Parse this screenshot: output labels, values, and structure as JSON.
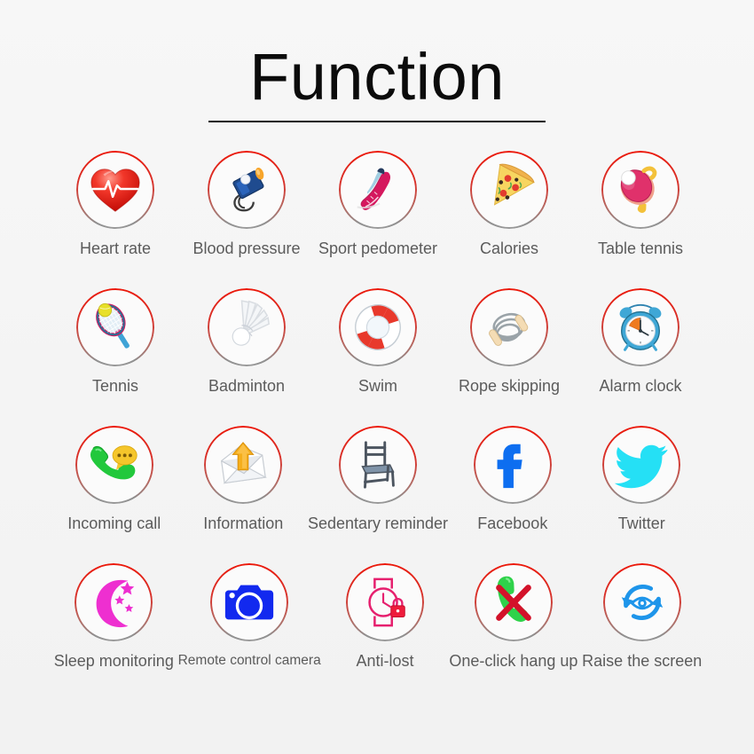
{
  "header": {
    "title": "Function"
  },
  "theme": {
    "background": "#f4f4f4",
    "ring_red": "#ec1708",
    "ring_gray": "#9a9a9a",
    "label_color": "#5b5b5b",
    "title_color": "#0b0b0b"
  },
  "grid": {
    "columns": 5,
    "rows": 4,
    "items": [
      {
        "label": "Heart rate",
        "icon": "heart-rate-icon"
      },
      {
        "label": "Blood pressure",
        "icon": "blood-pressure-monitor-icon"
      },
      {
        "label": "Sport pedometer",
        "icon": "running-shoe-icon"
      },
      {
        "label": "Calories",
        "icon": "pizza-slice-icon"
      },
      {
        "label": "Table tennis",
        "icon": "table-tennis-paddle-icon"
      },
      {
        "label": "Tennis",
        "icon": "tennis-racket-icon"
      },
      {
        "label": "Badminton",
        "icon": "shuttlecock-icon"
      },
      {
        "label": "Swim",
        "icon": "life-ring-icon"
      },
      {
        "label": "Rope skipping",
        "icon": "jump-rope-icon"
      },
      {
        "label": "Alarm clock",
        "icon": "alarm-clock-icon"
      },
      {
        "label": "Incoming call",
        "icon": "incoming-call-icon"
      },
      {
        "label": "Information",
        "icon": "envelope-message-icon"
      },
      {
        "label": "Sedentary reminder",
        "icon": "chair-icon"
      },
      {
        "label": "Facebook",
        "icon": "facebook-icon"
      },
      {
        "label": "Twitter",
        "icon": "twitter-bird-icon"
      },
      {
        "label": "Sleep monitoring",
        "icon": "moon-stars-icon"
      },
      {
        "label": "Remote control camera",
        "icon": "camera-icon",
        "label_size": "small"
      },
      {
        "label": "Anti-lost",
        "icon": "watch-lock-icon"
      },
      {
        "label": "One-click hang up",
        "icon": "hang-up-phone-icon"
      },
      {
        "label": "Raise the screen",
        "icon": "raise-to-wake-eye-icon"
      }
    ]
  }
}
